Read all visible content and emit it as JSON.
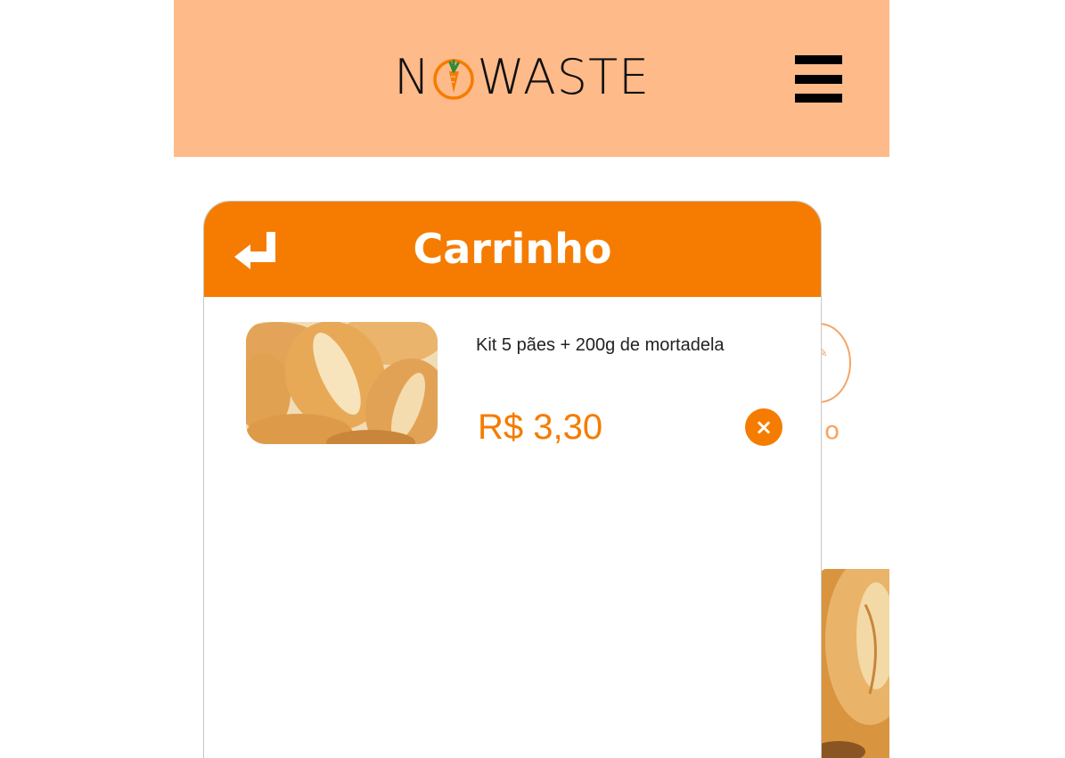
{
  "header": {
    "logo_letters_left": "N",
    "logo_letters_right": "WASTE",
    "logo_icon": "carrot-o-icon",
    "menu_icon": "hamburger-menu-icon",
    "background_color": "#ffba8a"
  },
  "cart": {
    "title": "Carrinho",
    "back_icon": "return-arrow-icon",
    "header_color": "#f57c00",
    "items": [
      {
        "name": "Kit 5 pães + 200g de mortadela",
        "price": "R$ 3,30",
        "image": "bread-rolls-photo",
        "remove_icon": "close-icon",
        "remove_label": "×"
      }
    ]
  },
  "background_page": {
    "partial_letter": "o",
    "accent_color": "#f5a566"
  }
}
